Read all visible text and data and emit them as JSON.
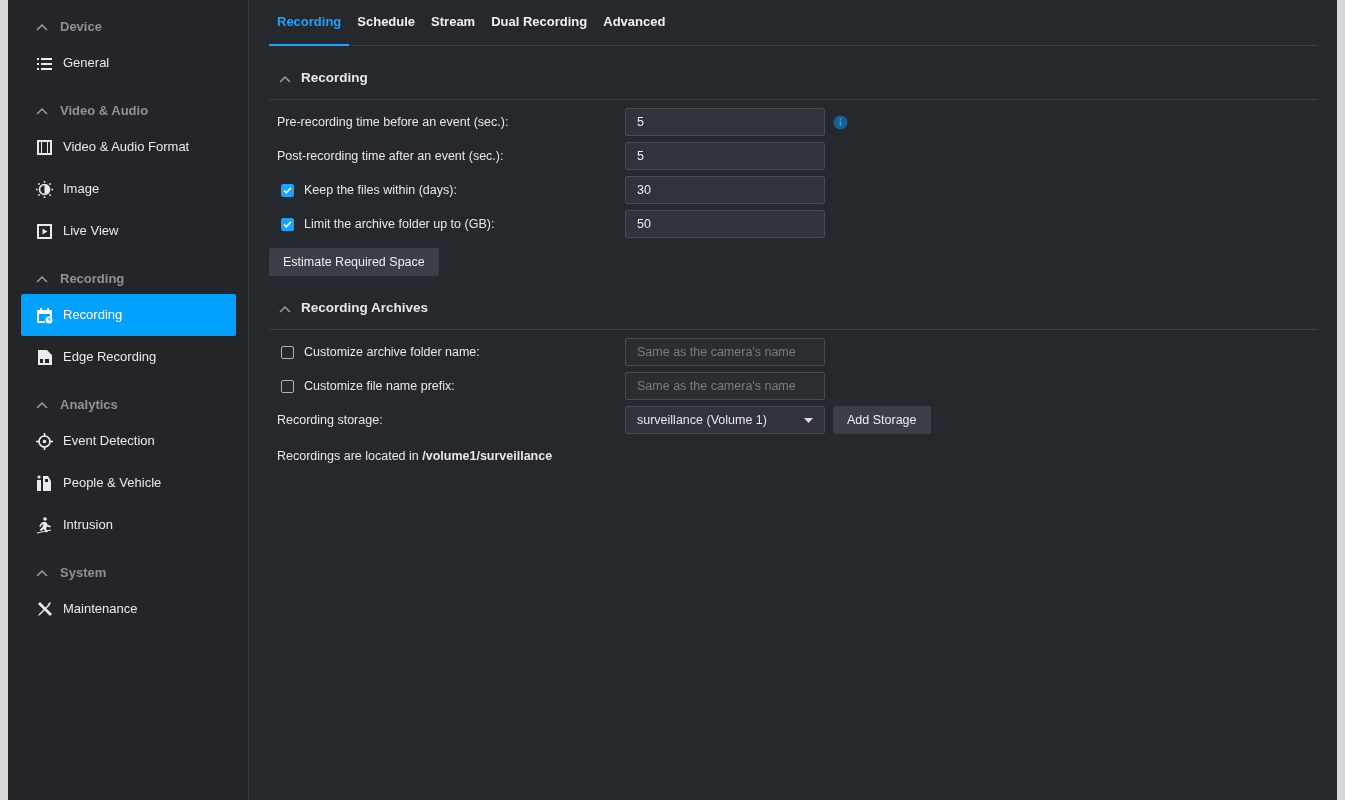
{
  "sidebar": {
    "groups": [
      {
        "title": "Device",
        "expanded": true,
        "items": [
          {
            "label": "General",
            "selected": false
          }
        ]
      },
      {
        "title": "Video & Audio",
        "expanded": true,
        "items": [
          {
            "label": "Video & Audio Format",
            "selected": false
          },
          {
            "label": "Image",
            "selected": false
          },
          {
            "label": "Live View",
            "selected": false
          }
        ]
      },
      {
        "title": "Recording",
        "expanded": true,
        "items": [
          {
            "label": "Recording",
            "selected": true
          },
          {
            "label": "Edge Recording",
            "selected": false
          }
        ]
      },
      {
        "title": "Analytics",
        "expanded": true,
        "items": [
          {
            "label": "Event Detection",
            "selected": false
          },
          {
            "label": "People & Vehicle",
            "selected": false
          },
          {
            "label": "Intrusion",
            "selected": false
          }
        ]
      },
      {
        "title": "System",
        "expanded": true,
        "items": [
          {
            "label": "Maintenance",
            "selected": false
          }
        ]
      }
    ]
  },
  "tabs": [
    {
      "label": "Recording",
      "selected": true
    },
    {
      "label": "Schedule",
      "selected": false
    },
    {
      "label": "Stream",
      "selected": false
    },
    {
      "label": "Dual Recording",
      "selected": false
    },
    {
      "label": "Advanced",
      "selected": false
    }
  ],
  "sections": [
    {
      "title": "Recording",
      "expanded": true,
      "rows": [
        {
          "kind": "number",
          "label": "Pre-recording time before an event (sec.):",
          "value": "5",
          "info": true
        },
        {
          "kind": "number",
          "label": "Post-recording time after an event (sec.):",
          "value": "5"
        },
        {
          "kind": "check",
          "label": "Keep the files within (days):",
          "checked": true,
          "value": "30"
        },
        {
          "kind": "check",
          "label": "Limit the archive folder up to (GB):",
          "checked": true,
          "value": "50"
        },
        {
          "kind": "button",
          "label": "Estimate Required Space"
        }
      ]
    },
    {
      "title": "Recording Archives",
      "expanded": true,
      "rows": [
        {
          "kind": "check",
          "label": "Customize archive folder name:",
          "checked": false,
          "placeholder": "Same as the camera's name"
        },
        {
          "kind": "check",
          "label": "Customize file name prefix:",
          "checked": false,
          "placeholder": "Same as the camera's name"
        },
        {
          "kind": "select",
          "label": "Recording storage:",
          "value": "surveillance (Volume 1)",
          "button": "Add Storage"
        },
        {
          "kind": "note",
          "label": "Recordings are located in **/volume1/surveillance**"
        }
      ]
    }
  ]
}
